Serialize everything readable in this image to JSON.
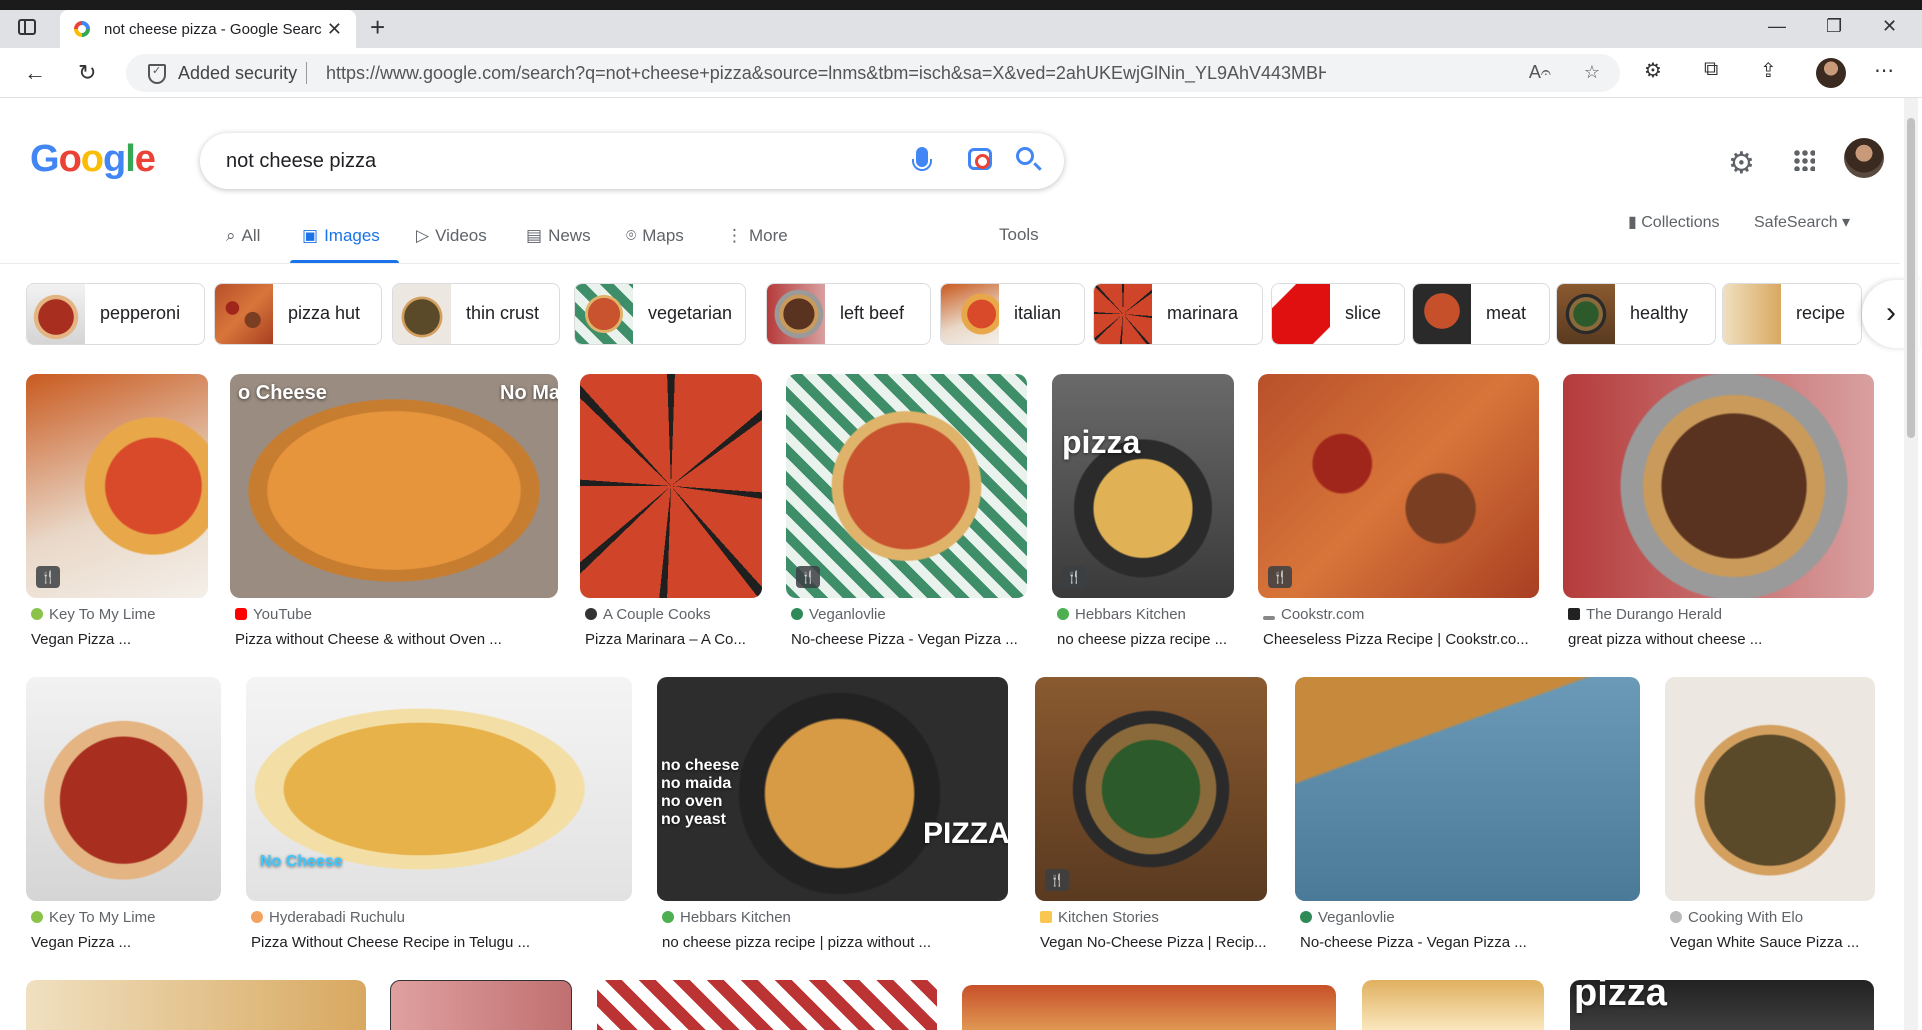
{
  "browser": {
    "tab_title": "not cheese pizza - Google Search",
    "security_label": "Added security",
    "url": "https://www.google.com/search?q=not+cheese+pizza&source=lnms&tbm=isch&sa=X&ved=2ahUKEwjGlNin_YL9AhV443MBHRlEDGMQ_AUoAXoECAEQ..."
  },
  "search": {
    "query": "not cheese pizza"
  },
  "tabs": [
    {
      "label": "All",
      "icon": "search-icon"
    },
    {
      "label": "Images",
      "icon": "image-icon",
      "active": true
    },
    {
      "label": "Videos",
      "icon": "play-icon"
    },
    {
      "label": "News",
      "icon": "news-icon"
    },
    {
      "label": "Maps",
      "icon": "map-pin-icon"
    },
    {
      "label": "More",
      "icon": "more-vert-icon"
    }
  ],
  "tools_label": "Tools",
  "collections_label": "Collections",
  "safesearch_label": "SafeSearch",
  "chips": [
    {
      "label": "pepperoni"
    },
    {
      "label": "pizza hut"
    },
    {
      "label": "thin crust"
    },
    {
      "label": "vegetarian"
    },
    {
      "label": "left beef"
    },
    {
      "label": "italian"
    },
    {
      "label": "marinara"
    },
    {
      "label": "slice"
    },
    {
      "label": "meat"
    },
    {
      "label": "healthy"
    },
    {
      "label": "recipe"
    }
  ],
  "results_row1": [
    {
      "source": "Key To My Lime",
      "title": "Vegan Pizza ...",
      "recipe": true
    },
    {
      "source": "YouTube",
      "title": "Pizza without Cheese & without Oven ...",
      "overlay_left": "o Cheese",
      "overlay_right": "No Ma"
    },
    {
      "source": "A Couple Cooks",
      "title": "Pizza Marinara – A Co..."
    },
    {
      "source": "Veganlovlie",
      "title": "No-cheese Pizza - Vegan Pizza ...",
      "recipe": true
    },
    {
      "source": "Hebbars Kitchen",
      "title": "no cheese pizza recipe ...",
      "recipe": true,
      "overlay": "pizza"
    },
    {
      "source": "Cookstr.com",
      "title": "Cheeseless Pizza Recipe | Cookstr.co...",
      "recipe": true
    },
    {
      "source": "The Durango Herald",
      "title": "great pizza without cheese ..."
    }
  ],
  "results_row2": [
    {
      "source": "Key To My Lime",
      "title": "Vegan Pizza ..."
    },
    {
      "source": "Hyderabadi Ruchulu",
      "title": "Pizza Without Cheese Recipe in Telugu ...",
      "overlay": "No Cheese"
    },
    {
      "source": "Hebbars Kitchen",
      "title": "no cheese pizza recipe | pizza without ...",
      "overlay_lines": [
        "no cheese",
        "no maida",
        "no oven",
        "no yeast"
      ],
      "overlay_right": "PIZZA"
    },
    {
      "source": "Kitchen Stories",
      "title": "Vegan No-Cheese Pizza | Recip...",
      "recipe": true
    },
    {
      "source": "Veganlovlie",
      "title": "No-cheese Pizza - Vegan Pizza ..."
    },
    {
      "source": "Cooking With Elo",
      "title": "Vegan White Sauce Pizza ..."
    }
  ],
  "row3_overlay": "pizza"
}
